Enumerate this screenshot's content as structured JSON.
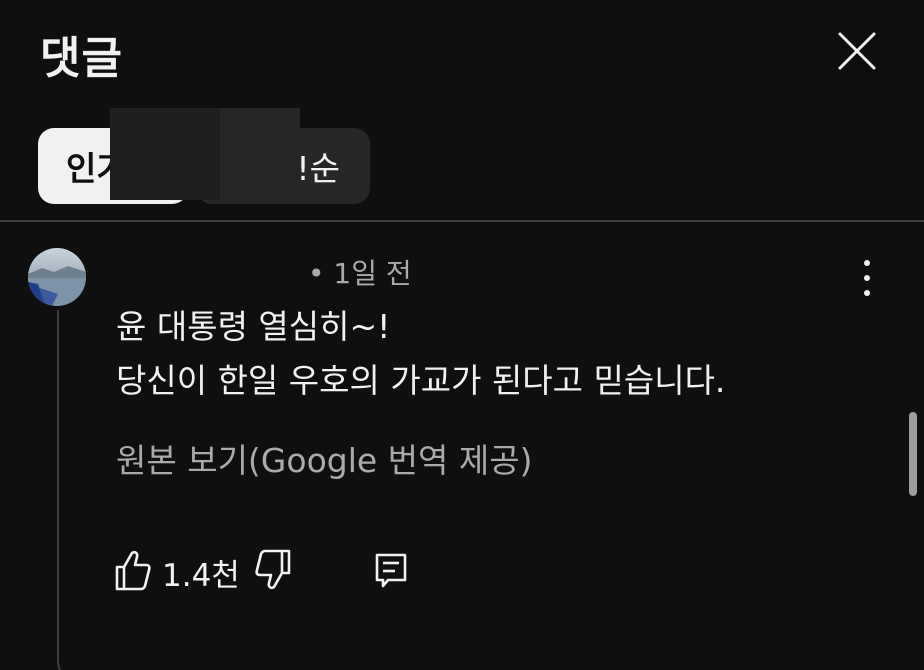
{
  "header": {
    "title": "댓글"
  },
  "sort": {
    "popular_label": "인기",
    "latest_label": "!순"
  },
  "comment": {
    "meta": "• 1일 전",
    "line1": "윤 대통령 열심히~!",
    "line2": "당신이 한일 우호의 가교가 된다고 믿습니다.",
    "translate_link": "원본 보기(Google 번역 제공)",
    "like_count": "1.4천"
  },
  "icons": {
    "close": "close-icon",
    "more": "more-vert-icon",
    "like": "thumb-up-icon",
    "dislike": "thumb-down-icon",
    "reply": "comment-icon"
  },
  "colors": {
    "background": "#0f0f0f",
    "primary_text": "#f1f1f1",
    "secondary_text": "#aaaaaa",
    "chip_selected_bg": "#f1f1f1",
    "chip_bg": "#272727"
  }
}
